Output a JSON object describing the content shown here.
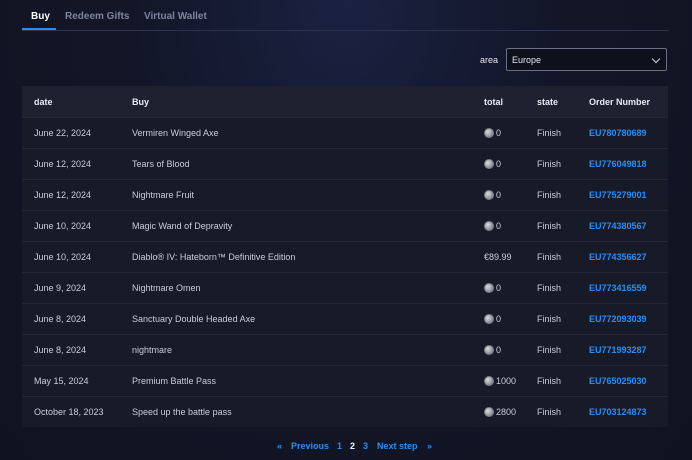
{
  "tabs": [
    {
      "label": "Buy",
      "active": true
    },
    {
      "label": "Redeem Gifts",
      "active": false
    },
    {
      "label": "Virtual Wallet",
      "active": false
    }
  ],
  "area": {
    "label": "area",
    "selected": "Europe"
  },
  "table": {
    "headers": {
      "date": "date",
      "buy": "Buy",
      "total": "total",
      "state": "state",
      "order": "Order Number"
    },
    "rows": [
      {
        "date": "June 22, 2024",
        "buy": "Vermiren Winged Axe",
        "total": "0",
        "coin": true,
        "state": "Finish",
        "order": "EU780780689"
      },
      {
        "date": "June 12, 2024",
        "buy": "Tears of Blood",
        "total": "0",
        "coin": true,
        "state": "Finish",
        "order": "EU776049818"
      },
      {
        "date": "June 12, 2024",
        "buy": "Nightmare Fruit",
        "total": "0",
        "coin": true,
        "state": "Finish",
        "order": "EU775279001"
      },
      {
        "date": "June 10, 2024",
        "buy": "Magic Wand of Depravity",
        "total": "0",
        "coin": true,
        "state": "Finish",
        "order": "EU774380567"
      },
      {
        "date": "June 10, 2024",
        "buy": "Diablo® IV: Hateborn™ Definitive Edition",
        "total": "€89.99",
        "coin": false,
        "state": "Finish",
        "order": "EU774356627"
      },
      {
        "date": "June 9, 2024",
        "buy": "Nightmare Omen",
        "total": "0",
        "coin": true,
        "state": "Finish",
        "order": "EU773416559"
      },
      {
        "date": "June 8, 2024",
        "buy": "Sanctuary Double Headed Axe",
        "total": "0",
        "coin": true,
        "state": "Finish",
        "order": "EU772093039"
      },
      {
        "date": "June 8, 2024",
        "buy": "nightmare",
        "total": "0",
        "coin": true,
        "state": "Finish",
        "order": "EU771993287"
      },
      {
        "date": "May 15, 2024",
        "buy": "Premium Battle Pass",
        "total": "1000",
        "coin": true,
        "state": "Finish",
        "order": "EU765025030"
      },
      {
        "date": "October 18, 2023",
        "buy": "Speed up the battle pass",
        "total": "2800",
        "coin": true,
        "state": "Finish",
        "order": "EU703124873"
      }
    ]
  },
  "pagination": {
    "first": "«",
    "previous": "Previous",
    "pages": [
      "1",
      "2",
      "3"
    ],
    "current_page": "2",
    "next": "Next step",
    "last": "»"
  },
  "colors": {
    "accent": "#2c8cf4",
    "background": "#121627",
    "row": "#171b28",
    "header": "#1d2130"
  }
}
